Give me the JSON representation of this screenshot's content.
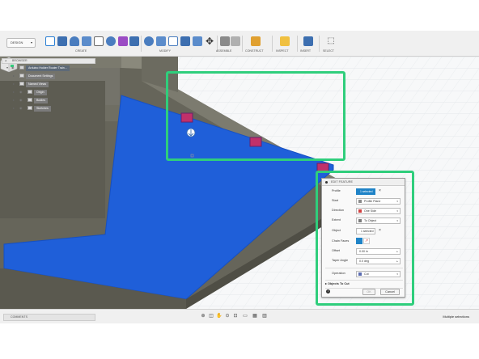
{
  "toolbar": {
    "workspace": "DESIGN",
    "groups": [
      "CREATE",
      "MODIFY",
      "ASSEMBLE",
      "CONSTRUCT",
      "INSPECT",
      "INSERT",
      "SELECT"
    ]
  },
  "browser": {
    "header": "BROWSER",
    "items": [
      {
        "label": "Arduino Holder Router Train..."
      },
      {
        "label": "Document Settings"
      },
      {
        "label": "Named Views"
      },
      {
        "label": "Origin"
      },
      {
        "label": "Bodies"
      },
      {
        "label": "Sketches"
      }
    ]
  },
  "dialog": {
    "title": "EDIT FEATURE",
    "rows": {
      "profile": {
        "label": "Profile",
        "value": "1 selected"
      },
      "start": {
        "label": "Start",
        "value": "Profile Plane"
      },
      "direction": {
        "label": "Direction",
        "value": "One Side"
      },
      "extent": {
        "label": "Extent",
        "value": "To Object"
      },
      "object": {
        "label": "Object",
        "value": "1 selected"
      },
      "chain": {
        "label": "Chain Faces"
      },
      "offset": {
        "label": "Offset",
        "value": "0.00 in"
      },
      "taper": {
        "label": "Taper Angle",
        "value": "0.0 deg"
      },
      "operation": {
        "label": "Operation",
        "value": "Cut"
      }
    },
    "section": "Objects To Cut",
    "ok": "OK",
    "cancel": "Cancel"
  },
  "bottom": {
    "comments": "COMMENTS",
    "status": "Multiple selections"
  },
  "colors": {
    "highlight": "#2fce7c",
    "profile_fill": "#1f5fd9",
    "accent": "#1f83c7",
    "body": "#6d6b5e"
  }
}
